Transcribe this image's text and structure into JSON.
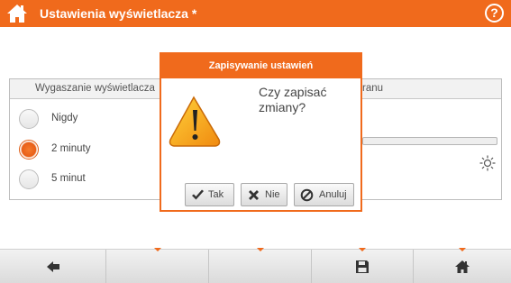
{
  "header": {
    "title": "Ustawienia wyświetlacza *",
    "home_icon": "home-icon",
    "help_label": "?"
  },
  "left_panel": {
    "title": "Wygaszanie wyświetlacza",
    "options": [
      {
        "label": "Nigdy",
        "selected": false
      },
      {
        "label": "2 minuty",
        "selected": true
      },
      {
        "label": "5 minut",
        "selected": false
      }
    ]
  },
  "right_panel": {
    "title": "ranu",
    "brightness_icon": "sun-icon"
  },
  "dialog": {
    "title": "Zapisywanie ustawień",
    "message": "Czy zapisać zmiany?",
    "icon": "warning-icon",
    "buttons": {
      "yes": "Tak",
      "no": "Nie",
      "cancel": "Anuluj"
    }
  },
  "toolbar": {
    "buttons": [
      {
        "name": "back",
        "icon": "arrow-left-icon"
      },
      {
        "name": "empty-2",
        "icon": ""
      },
      {
        "name": "empty-3",
        "icon": ""
      },
      {
        "name": "save",
        "icon": "save-icon"
      },
      {
        "name": "home",
        "icon": "home-icon"
      }
    ]
  },
  "colors": {
    "accent": "#f06a1c",
    "panel_header": "#f2f2f2",
    "toolbar": "#e4e4e4"
  }
}
